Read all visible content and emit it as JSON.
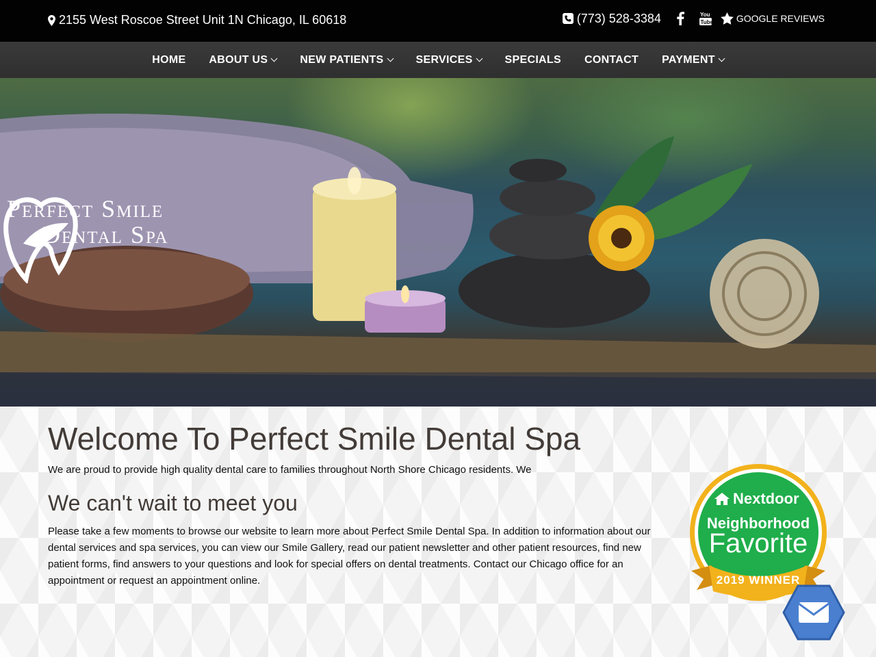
{
  "topbar": {
    "address": "2155 West Roscoe Street Unit 1N Chicago, IL 60618",
    "phone": "(773) 528-3384",
    "reviews_label": "GOOGLE REVIEWS"
  },
  "nav": {
    "items": [
      {
        "label": "HOME",
        "dropdown": false
      },
      {
        "label": "ABOUT US",
        "dropdown": true
      },
      {
        "label": "NEW PATIENTS",
        "dropdown": true
      },
      {
        "label": "SERVICES",
        "dropdown": true
      },
      {
        "label": "SPECIALS",
        "dropdown": false
      },
      {
        "label": "CONTACT",
        "dropdown": false
      },
      {
        "label": "PAYMENT",
        "dropdown": true
      }
    ]
  },
  "logo": {
    "line1": "Perfect Smile",
    "line2": "Dental Spa"
  },
  "main": {
    "title": "Welcome To Perfect Smile Dental Spa",
    "intro": "We are proud to provide high quality dental care to families throughout North Shore Chicago residents. We",
    "subtitle": "We can't wait to meet you",
    "paragraph": "Please take a few moments to browse our website to learn more about Perfect Smile Dental Spa. In addition to information about our dental services and spa services, you can view our Smile Gallery, read our patient newsletter and other patient resources, find new patient forms, find answers to your questions and look for special offers on dental treatments. Contact our Chicago office for an appointment or request an appointment online."
  },
  "badge": {
    "brand": "Nextdoor",
    "line1": "Neighborhood",
    "line2": "Favorite",
    "ribbon": "2019 WINNER"
  },
  "colors": {
    "topbar_bg": "#020202",
    "nav_bg": "#333333",
    "heading": "#423b37",
    "badge_green": "#1fae4b",
    "badge_gold": "#f2b21c",
    "mail_blue": "#4a7fd0"
  }
}
